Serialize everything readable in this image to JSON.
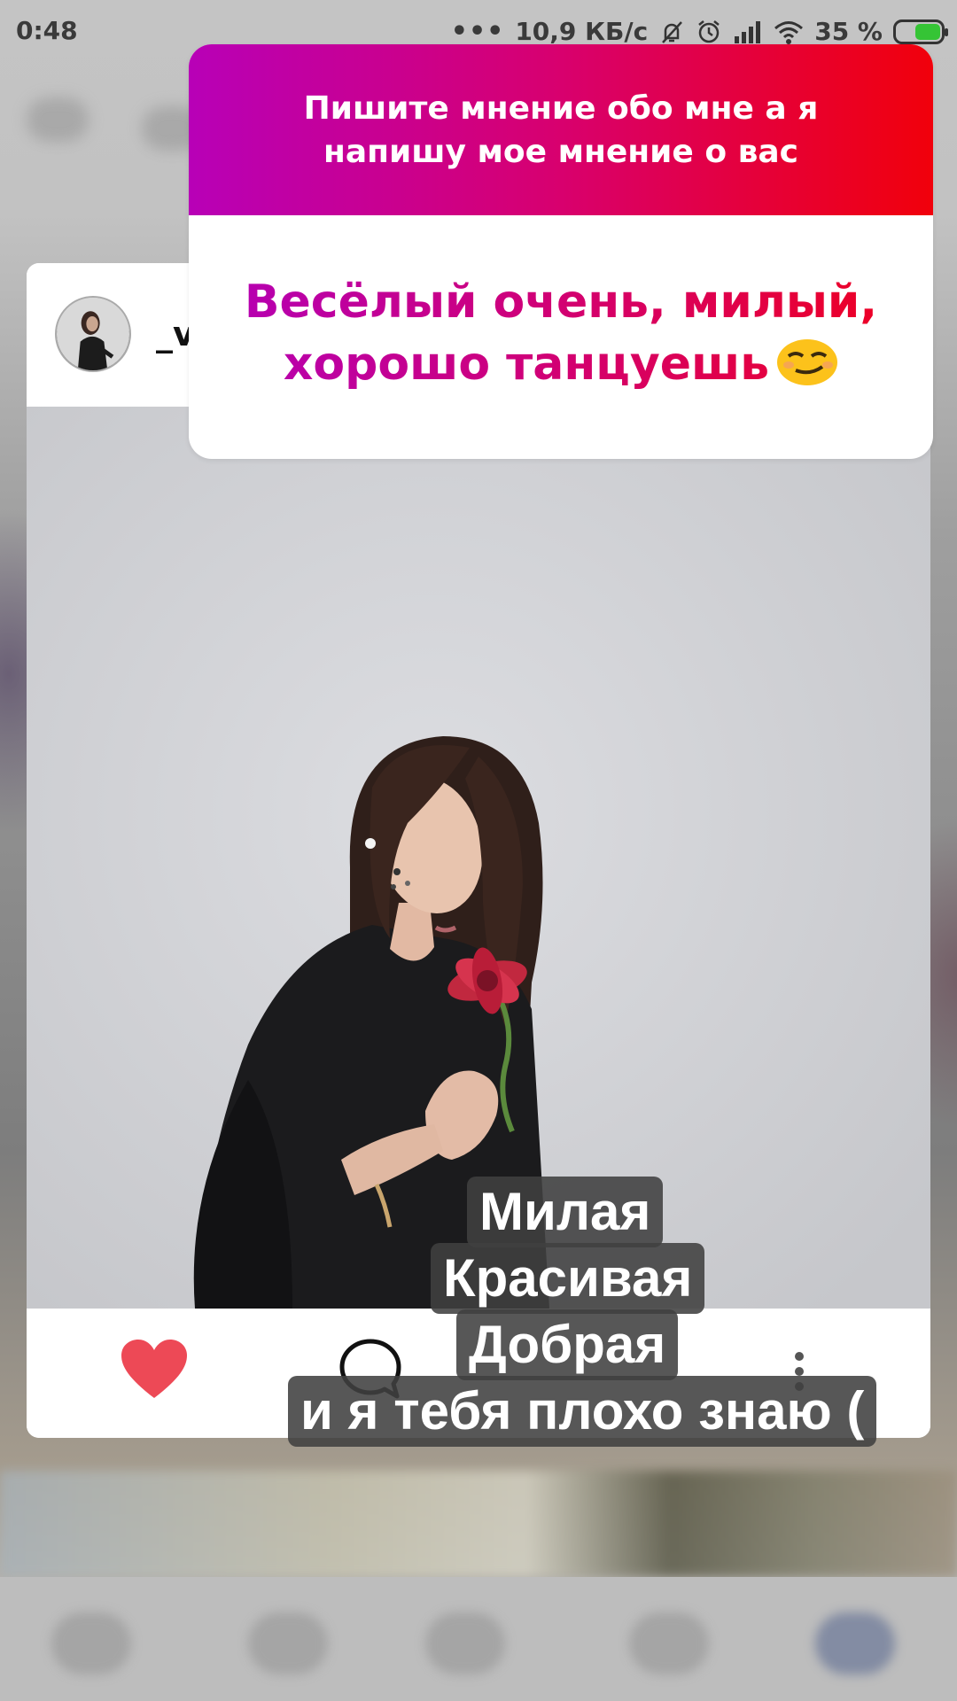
{
  "status_bar": {
    "time": "0:48",
    "more_dots": "•••",
    "speed": "10,9 КБ/с",
    "battery": "35 %",
    "icons": [
      "mute-bell-icon",
      "alarm-icon",
      "signal-icon",
      "wifi-icon",
      "battery-charging-icon"
    ]
  },
  "post": {
    "username": "_v",
    "actions": [
      "heart-icon",
      "comment-icon",
      "more-icon"
    ],
    "colors": {
      "heart": "#ed4956"
    }
  },
  "sticker": {
    "question": "Пишите мнение обо мне а я напишу мое мнение о вас",
    "answer": "Весёлый очень, милый, хорошо танцуешь",
    "emoji": "smirking-face-icon",
    "gradient": [
      "#b800b7",
      "#f1000b"
    ]
  },
  "overlay_text": {
    "line1": "Милая",
    "line2": "Красивая",
    "line3": "Добрая",
    "line4": "и я тебя плохо знаю ("
  }
}
